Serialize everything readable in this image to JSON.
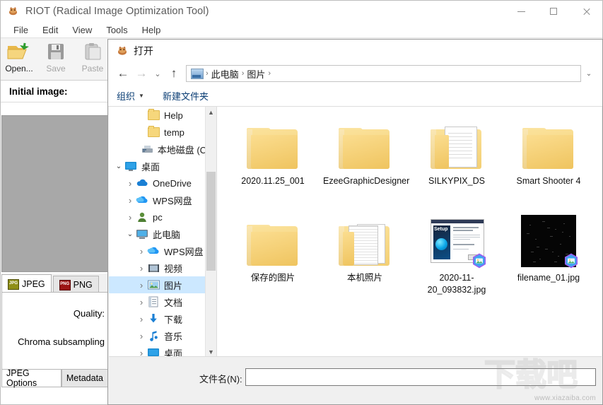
{
  "app": {
    "title": "RIOT (Radical Image Optimization Tool)",
    "icon": "riot-app-icon",
    "menu": [
      "File",
      "Edit",
      "View",
      "Tools",
      "Help"
    ],
    "window_buttons": {
      "minimize": "minimize",
      "maximize": "maximize",
      "close": "close"
    },
    "toolbar": [
      {
        "label": "Open...",
        "icon": "open-folder-icon",
        "disabled": false
      },
      {
        "label": "Save",
        "icon": "save-disk-icon",
        "disabled": true
      },
      {
        "label": "Paste",
        "icon": "paste-clipboard-icon",
        "disabled": true
      }
    ],
    "initial_image_label": "Initial image:",
    "format_tabs": [
      {
        "label": "JPEG",
        "icon": "jpg-file-icon",
        "badge": "JPG",
        "active": true
      },
      {
        "label": "PNG",
        "icon": "png-file-icon",
        "badge": "PNG",
        "active": false
      }
    ],
    "options": {
      "quality_label": "Quality:",
      "chroma_label": "Chroma subsampling"
    },
    "bottom_tabs": [
      {
        "label": "JPEG Options",
        "active": true
      },
      {
        "label": "Metadata",
        "active": false
      }
    ]
  },
  "dialog": {
    "title": "打开",
    "title_icon": "riot-app-icon",
    "nav": {
      "back": "←",
      "forward": "→",
      "recent": "⌄",
      "up": "↑",
      "dropdown": "⌄"
    },
    "address": {
      "icon": "pictures-library-icon",
      "crumbs": [
        "此电脑",
        "图片"
      ],
      "separator": "›"
    },
    "commands": [
      {
        "label": "组织",
        "caret": "▼",
        "has_caret": true
      },
      {
        "label": "新建文件夹",
        "has_caret": false
      }
    ],
    "tree": [
      {
        "label": "Help",
        "icon": "folder-icon",
        "twisty": "",
        "indent": 2,
        "selected": false
      },
      {
        "label": "temp",
        "icon": "folder-icon",
        "twisty": "",
        "indent": 2,
        "selected": false
      },
      {
        "label": "本地磁盘 (C:)",
        "icon": "local-disk-icon",
        "twisty": "",
        "indent": 2,
        "selected": false
      },
      {
        "label": "桌面",
        "icon": "desktop-icon",
        "twisty": "⌄",
        "indent": 0,
        "selected": false
      },
      {
        "label": "OneDrive",
        "icon": "onedrive-cloud-icon",
        "twisty": "›",
        "indent": 1,
        "selected": false
      },
      {
        "label": "WPS网盘",
        "icon": "wps-cloud-icon",
        "twisty": "›",
        "indent": 1,
        "selected": false
      },
      {
        "label": "pc",
        "icon": "user-icon",
        "twisty": "›",
        "indent": 1,
        "selected": false
      },
      {
        "label": "此电脑",
        "icon": "this-pc-icon",
        "twisty": "⌄",
        "indent": 1,
        "selected": false
      },
      {
        "label": "WPS网盘",
        "icon": "wps-cloud-icon",
        "twisty": "›",
        "indent": 2,
        "selected": false
      },
      {
        "label": "视频",
        "icon": "videos-icon",
        "twisty": "›",
        "indent": 2,
        "selected": false
      },
      {
        "label": "图片",
        "icon": "pictures-icon",
        "twisty": "›",
        "indent": 2,
        "selected": true
      },
      {
        "label": "文档",
        "icon": "documents-icon",
        "twisty": "›",
        "indent": 2,
        "selected": false
      },
      {
        "label": "下载",
        "icon": "downloads-icon",
        "twisty": "›",
        "indent": 2,
        "selected": false
      },
      {
        "label": "音乐",
        "icon": "music-icon",
        "twisty": "›",
        "indent": 2,
        "selected": false
      },
      {
        "label": "桌面",
        "icon": "desktop-icon",
        "twisty": "›",
        "indent": 2,
        "selected": false
      }
    ],
    "files": [
      {
        "name": "2020.11.25_001",
        "kind": "folder"
      },
      {
        "name": "EzeeGraphicDesigner",
        "kind": "folder"
      },
      {
        "name": "SILKYPIX_DS",
        "kind": "folder-doc"
      },
      {
        "name": "Smart Shooter 4",
        "kind": "folder"
      },
      {
        "name": "保存的图片",
        "kind": "folder"
      },
      {
        "name": "本机照片",
        "kind": "folder-docs"
      },
      {
        "name": "2020-11-20_093832.jpg",
        "kind": "image-setup",
        "badge": "onedrive-sync-badge"
      },
      {
        "name": "filename_01.jpg",
        "kind": "image-dark",
        "badge": "onedrive-sync-badge"
      }
    ],
    "filename": {
      "label": "文件名(N):",
      "value": "",
      "placeholder": ""
    }
  },
  "watermark": {
    "text": "下载吧",
    "url": "www.xiazaiba.com"
  },
  "colors": {
    "selection": "#cce8ff",
    "folder": "#f3cf74",
    "link": "#0a3d74",
    "accent": "#0078d7"
  }
}
